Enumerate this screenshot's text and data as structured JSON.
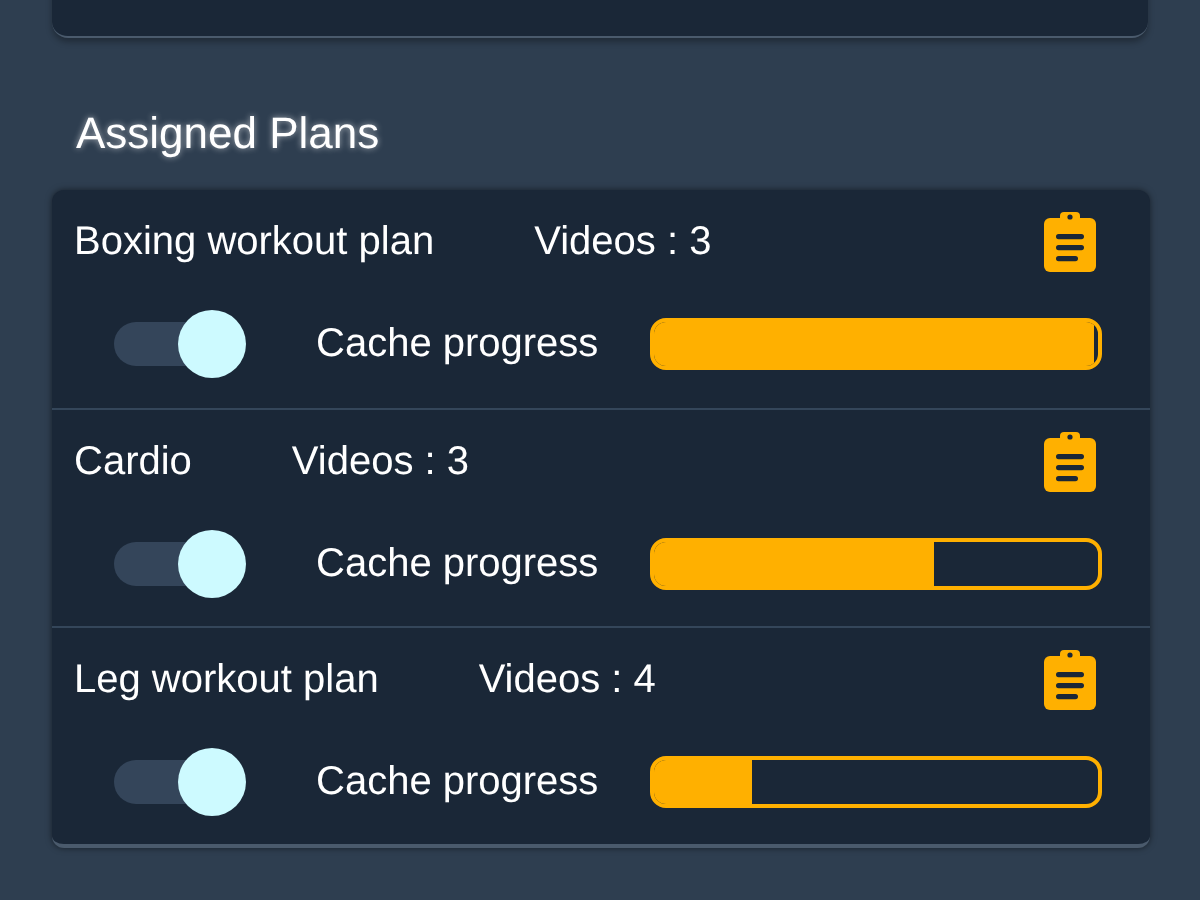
{
  "section_title": "Assigned Plans",
  "plans": [
    {
      "name": "Boxing workout plan",
      "videos": "Videos : 3",
      "cache_on": true,
      "cache_label": "Cache progress",
      "level": 0.99
    },
    {
      "name": "Cardio",
      "videos": "Videos : 3",
      "cache_on": true,
      "cache_label": "Cache progress",
      "level": 0.63
    },
    {
      "name": "Leg workout plan",
      "videos": "Videos : 4",
      "cache_on": true,
      "cache_label": "Cache progress",
      "level": 0.22
    }
  ]
}
